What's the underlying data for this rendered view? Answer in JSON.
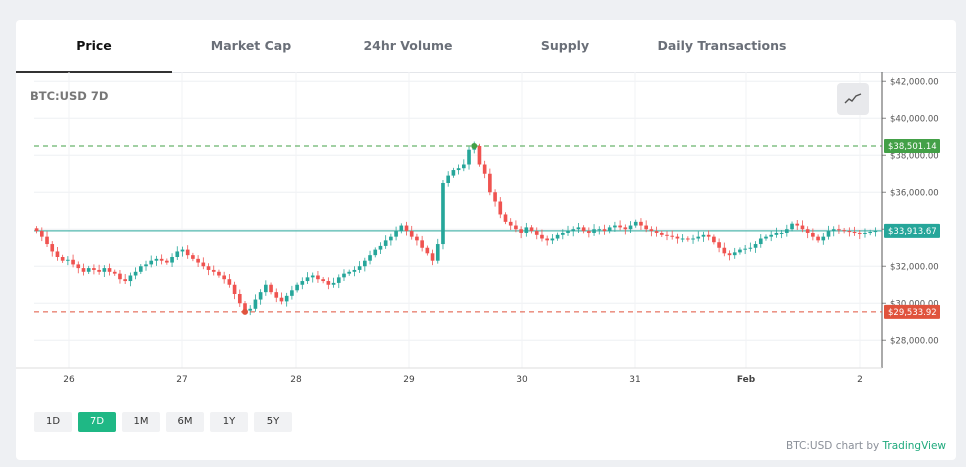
{
  "tabs": [
    {
      "label": "Price",
      "active": true
    },
    {
      "label": "Market Cap",
      "active": false
    },
    {
      "label": "24hr Volume",
      "active": false
    },
    {
      "label": "Supply",
      "active": false
    },
    {
      "label": "Daily Transactions",
      "active": false
    }
  ],
  "chart_title": "BTC:USD 7D",
  "chart_type_icon": "line-chart-icon",
  "ranges": [
    {
      "label": "1D",
      "active": false
    },
    {
      "label": "7D",
      "active": true
    },
    {
      "label": "1M",
      "active": false
    },
    {
      "label": "6M",
      "active": false
    },
    {
      "label": "1Y",
      "active": false
    },
    {
      "label": "5Y",
      "active": false
    }
  ],
  "attribution": {
    "prefix": "BTC:USD chart by ",
    "brand": "TradingView"
  },
  "colors": {
    "accent": "#1fb885",
    "up": "#26a69a",
    "down": "#ef5350",
    "high": "#43a047",
    "low": "#e0533d",
    "current": "#26a69a"
  },
  "chart_data": {
    "type": "line",
    "title": "BTC:USD 7D",
    "x_ticks": [
      "26",
      "27",
      "28",
      "29",
      "30",
      "31",
      "Feb",
      "2"
    ],
    "y_ticks": [
      "$42,000.00",
      "$40,000.00",
      "$38,000.00",
      "$36,000.00",
      "$34,000.00",
      "$32,000.00",
      "$30,000.00",
      "$28,000.00"
    ],
    "ylim": [
      26500,
      42500
    ],
    "markers": {
      "high": {
        "label": "$38,501.14",
        "value": 38501.14
      },
      "current": {
        "label": "$33,913.67",
        "value": 33913.67
      },
      "low": {
        "label": "$29,533.92",
        "value": 29533.92
      }
    },
    "series": [
      {
        "values": [
          33900,
          33600,
          33200,
          32800,
          32500,
          32300,
          32350,
          32100,
          31900,
          31700,
          31900,
          31800,
          31700,
          31900,
          31700,
          31600,
          31300,
          31200,
          31500,
          31700,
          32000,
          32100,
          32300,
          32400,
          32300,
          32200,
          32500,
          32800,
          32900,
          32600,
          32400,
          32200,
          32000,
          31800,
          31700,
          31500,
          31300,
          31000,
          30500,
          30000,
          29600,
          29700,
          30200,
          30600,
          31000,
          30600,
          30300,
          30100,
          30400,
          30700,
          31000,
          31200,
          31400,
          31500,
          31300,
          31200,
          31000,
          31100,
          31400,
          31600,
          31700,
          31800,
          32000,
          32300,
          32600,
          32900,
          33100,
          33400,
          33600,
          33900,
          34200,
          33900,
          33600,
          33400,
          33000,
          32700,
          32300,
          33200,
          36500,
          36900,
          37200,
          37300,
          37500,
          38300,
          38500,
          37500,
          37000,
          36000,
          35500,
          34800,
          34400,
          34200,
          34000,
          33800,
          34100,
          33900,
          33700,
          33500,
          33400,
          33500,
          33700,
          33800,
          33900,
          34000,
          34100,
          33900,
          33800,
          34000,
          34000,
          33900,
          34100,
          34200,
          34100,
          34000,
          34200,
          34400,
          34200,
          34000,
          33900,
          33800,
          33700,
          33650,
          33600,
          33500,
          33500,
          33450,
          33500,
          33600,
          33700,
          33600,
          33300,
          33000,
          32700,
          32600,
          32750,
          32900,
          32950,
          33000,
          33200,
          33500,
          33600,
          33700,
          33800,
          33800,
          34000,
          34300,
          34200,
          34000,
          33800,
          33600,
          33400,
          33600,
          33900,
          34000,
          33950,
          33900,
          33850,
          33800,
          33750,
          33800,
          33850,
          33900
        ]
      }
    ]
  }
}
